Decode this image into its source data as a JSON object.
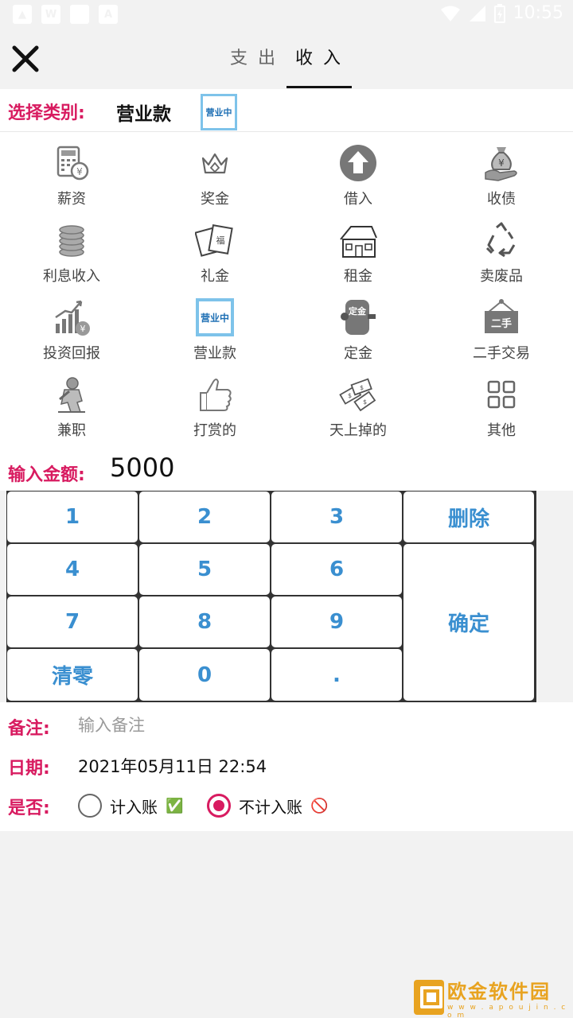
{
  "status_bar": {
    "time": "10:55"
  },
  "header": {
    "tabs": [
      {
        "label": "支 出"
      },
      {
        "label": "收 入",
        "active": true
      }
    ]
  },
  "category": {
    "label": "选择类别:",
    "selected": "营业款",
    "thumb_text": "营业中"
  },
  "categories": [
    {
      "label": "薪资",
      "icon": "calculator-yen-icon"
    },
    {
      "label": "奖金",
      "icon": "crown-icon"
    },
    {
      "label": "借入",
      "icon": "arrow-up-circle-icon"
    },
    {
      "label": "收债",
      "icon": "money-bag-hand-icon"
    },
    {
      "label": "利息收入",
      "icon": "coin-stack-icon"
    },
    {
      "label": "礼金",
      "icon": "gift-envelope-icon"
    },
    {
      "label": "租金",
      "icon": "house-icon"
    },
    {
      "label": "卖废品",
      "icon": "recycle-icon"
    },
    {
      "label": "投资回报",
      "icon": "growth-chart-icon"
    },
    {
      "label": "营业款",
      "icon": "open-sign-icon",
      "icon_text": "营业中"
    },
    {
      "label": "定金",
      "icon": "deposit-barrel-icon",
      "icon_text": "定金"
    },
    {
      "label": "二手交易",
      "icon": "second-hand-sign-icon",
      "icon_text": "二手"
    },
    {
      "label": "兼职",
      "icon": "worker-icon"
    },
    {
      "label": "打赏的",
      "icon": "thumbs-up-icon"
    },
    {
      "label": "天上掉的",
      "icon": "falling-money-icon"
    },
    {
      "label": "其他",
      "icon": "grid-four-icon"
    }
  ],
  "amount": {
    "label": "输入金额:",
    "value": "5000"
  },
  "keypad": {
    "k1": "1",
    "k2": "2",
    "k3": "3",
    "del": "删除",
    "k4": "4",
    "k5": "5",
    "k6": "6",
    "ok": "确定",
    "k7": "7",
    "k8": "8",
    "k9": "9",
    "clear": "清零",
    "k0": "0",
    "dot": "."
  },
  "note": {
    "label": "备注:",
    "placeholder": "输入备注"
  },
  "date": {
    "label": "日期:",
    "value": "2021年05月11日 22:54"
  },
  "account": {
    "label": "是否:",
    "options": [
      {
        "label": "计入账",
        "mark": "✅",
        "selected": false
      },
      {
        "label": "不计入账",
        "mark": "🚫",
        "selected": true
      }
    ]
  },
  "watermark": {
    "title": "欧金软件园",
    "url": "w w w . a p o u j i n . c o m"
  },
  "colors": {
    "accent": "#d81b60",
    "key_text": "#3a8fd0",
    "background": "#f2f2f2"
  }
}
